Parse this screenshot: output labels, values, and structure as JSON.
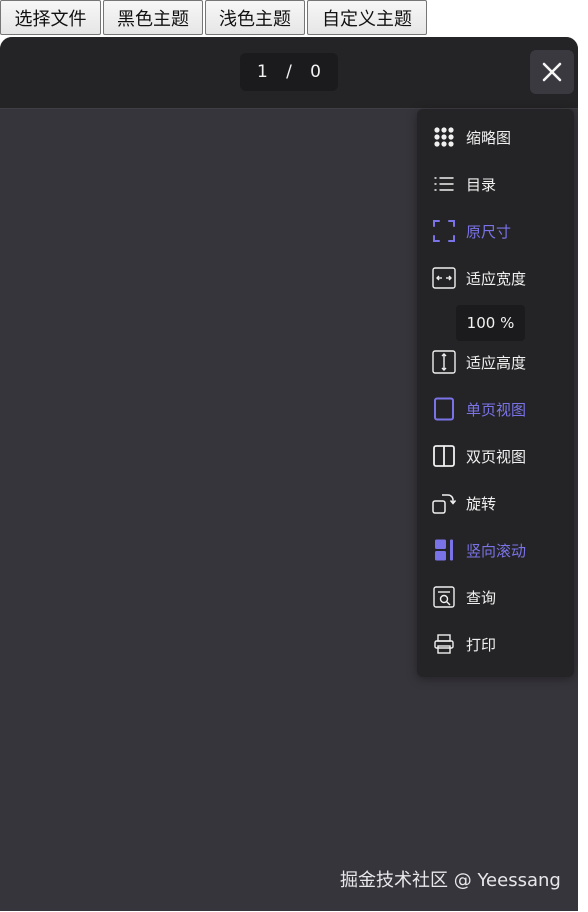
{
  "top_buttons": [
    "选择文件",
    "黑色主题",
    "浅色主题",
    "自定义主题"
  ],
  "viewer": {
    "page_current": "1",
    "page_separator": "/",
    "page_total": "0",
    "close_icon": "close-icon"
  },
  "menu": {
    "items": [
      {
        "label": "缩略图",
        "icon": "grid-icon",
        "active": false
      },
      {
        "label": "目录",
        "icon": "list-icon",
        "active": false
      },
      {
        "label": "原尺寸",
        "icon": "original-size-icon",
        "active": true
      },
      {
        "label": "适应宽度",
        "icon": "fit-width-icon",
        "active": false
      },
      {
        "label": "适应高度",
        "icon": "fit-height-icon",
        "active": false
      },
      {
        "label": "单页视图",
        "icon": "single-page-icon",
        "active": true
      },
      {
        "label": "双页视图",
        "icon": "double-page-icon",
        "active": false
      },
      {
        "label": "旋转",
        "icon": "rotate-icon",
        "active": false
      },
      {
        "label": "竖向滚动",
        "icon": "vertical-scroll-icon",
        "active": true
      },
      {
        "label": "查询",
        "icon": "search-icon",
        "active": false
      },
      {
        "label": "打印",
        "icon": "print-icon",
        "active": false
      }
    ],
    "zoom_value": "100 %"
  },
  "watermark": "掘金技术社区 @ Yeessang",
  "colors": {
    "accent": "#7a73e8",
    "header_bg": "#242426",
    "canvas_bg": "#36353b",
    "menu_bg": "#242426"
  }
}
